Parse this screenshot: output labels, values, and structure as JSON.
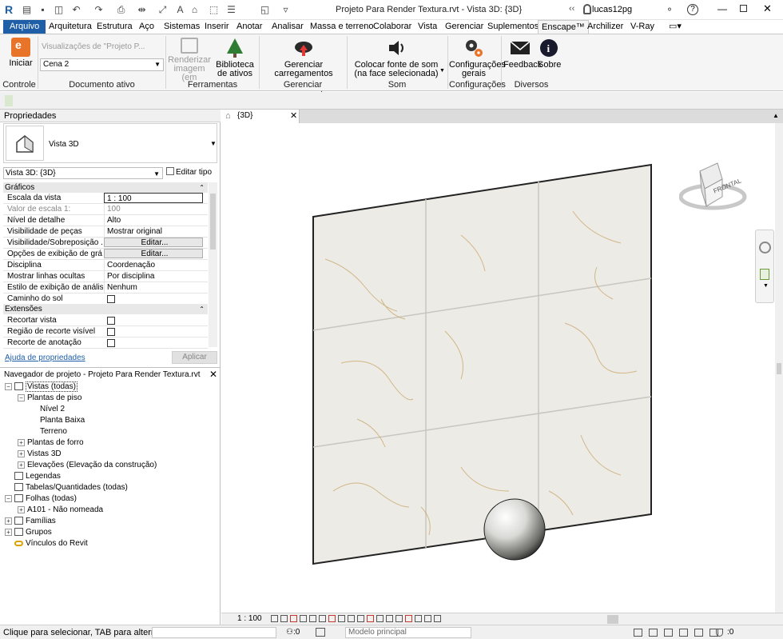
{
  "app": {
    "logo": "R",
    "doc_title": "Projeto Para Render Textura.rvt - Vista 3D: {3D}",
    "user": "lucas12pg"
  },
  "quick_access": [
    "open-icon",
    "save-icon",
    "sync-icon",
    "undo-icon",
    "redo-icon",
    "print-icon",
    "measure-icon",
    "dimension-icon",
    "text-icon",
    "3d-view-icon",
    "section-icon",
    "thin-lines-icon",
    "close-windows-icon",
    "switch-windows-icon"
  ],
  "tabs": [
    "Arquivo",
    "Arquitetura",
    "Estrutura",
    "Aço",
    "Sistemas",
    "Inserir",
    "Anotar",
    "Analisar",
    "Massa e terreno",
    "Colaborar",
    "Vista",
    "Gerenciar",
    "Suplementos",
    "Enscape™",
    "Archilizer",
    "V-Ray"
  ],
  "ribbon": {
    "iniciar": "Iniciar",
    "views_placeholder": "Visualizações de \"Projeto P...",
    "scene_value": "Cena 2",
    "render": "Renderizar imagem (em",
    "library": "Biblioteca de ativos",
    "manage_uploads": "Gerenciar carregamentos",
    "sound": "Colocar fonte de som (na face selecionada)",
    "settings": "Configurações gerais",
    "feedback": "Feedback",
    "about": "Sobre",
    "panels": [
      "Controle",
      "Documento ativo",
      "Ferramentas",
      "Gerenciar carregamentos",
      "Som",
      "Configurações",
      "Diversos"
    ]
  },
  "properties": {
    "title": "Propriedades",
    "type_name": "Vista 3D",
    "selector": "Vista 3D: {3D}",
    "edit_type": "Editar tipo",
    "group_graphics": "Gráficos",
    "rows": [
      {
        "k": "Escala da vista",
        "v": "1 : 100"
      },
      {
        "k": "Valor de escala    1:",
        "v": "100"
      },
      {
        "k": "Nível de detalhe",
        "v": "Alto"
      },
      {
        "k": "Visibilidade de peças",
        "v": "Mostrar original"
      },
      {
        "k": "Visibilidade/Sobreposição ...",
        "v": "Editar..."
      },
      {
        "k": "Opções de exibição de grá...",
        "v": "Editar..."
      },
      {
        "k": "Disciplina",
        "v": "Coordenação"
      },
      {
        "k": "Mostrar linhas ocultas",
        "v": "Por disciplina"
      },
      {
        "k": "Estilo de exibição de anális...",
        "v": "Nenhum"
      },
      {
        "k": "Caminho do sol",
        "v": ""
      }
    ],
    "group_extents": "Extensões",
    "rows2": [
      {
        "k": "Recortar vista"
      },
      {
        "k": "Região de recorte visível"
      },
      {
        "k": "Recorte de anotação"
      }
    ],
    "help": "Ajuda de propriedades",
    "apply": "Aplicar"
  },
  "browser": {
    "title": "Navegador de projeto - Projeto Para Render Textura.rvt",
    "items": [
      {
        "label": "Vistas (todas)",
        "exp": "−",
        "icon": "views-icon"
      },
      {
        "label": "Plantas de piso",
        "exp": "−",
        "icon": ""
      },
      {
        "label": "Nível 2",
        "exp": "",
        "icon": ""
      },
      {
        "label": "Planta Baixa",
        "exp": "",
        "icon": ""
      },
      {
        "label": "Terreno",
        "exp": "",
        "icon": ""
      },
      {
        "label": "Plantas de forro",
        "exp": "+",
        "icon": ""
      },
      {
        "label": "Vistas 3D",
        "exp": "+",
        "icon": ""
      },
      {
        "label": "Elevações (Elevação da construção)",
        "exp": "+",
        "icon": ""
      },
      {
        "label": "Legendas",
        "exp": "",
        "icon": "legend-icon"
      },
      {
        "label": "Tabelas/Quantidades (todas)",
        "exp": "",
        "icon": "schedule-icon"
      },
      {
        "label": "Folhas (todas)",
        "exp": "−",
        "icon": "sheet-icon"
      },
      {
        "label": "A101 - Não nomeada",
        "exp": "+",
        "icon": ""
      },
      {
        "label": "Famílias",
        "exp": "+",
        "icon": "family-icon"
      },
      {
        "label": "Grupos",
        "exp": "+",
        "icon": "group-icon"
      },
      {
        "label": "Vínculos do Revit",
        "exp": "",
        "icon": "link-icon"
      }
    ]
  },
  "view": {
    "tab": "{3D}",
    "cube": "FRONTAL",
    "scale": "1 : 100"
  },
  "status": {
    "hint": "Clique para selecionar, TAB para alternat",
    "zero1": ":0",
    "model": "Modelo principal",
    "zero2": ":0"
  },
  "colors": {
    "file_tab": "#1f5fa8",
    "tile": "#ecebe5",
    "grout": "#c8c6bf",
    "vein": "#c9a56a"
  }
}
